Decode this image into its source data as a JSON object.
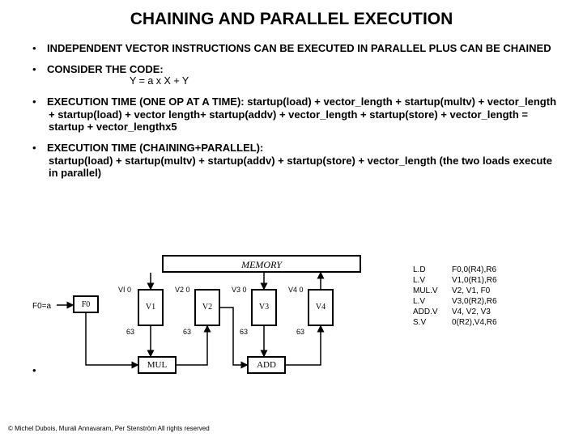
{
  "title": "CHAINING AND PARALLEL EXECUTION",
  "bullets": {
    "b1": "INDEPENDENT VECTOR INSTRUCTIONS CAN BE EXECUTED IN PARALLEL PLUS CAN BE CHAINED",
    "b2": "CONSIDER THE CODE:",
    "b2sub": "Y = a x X + Y",
    "b3label": "EXECUTION TIME (ONE OP AT A TIME):",
    "b3rest": " startup(load) + vector_length + startup(multv) + vector_length + startup(load) + vector length+ startup(addv) + vector_length + startup(store) + vector_length = startup + vector_lengthx5",
    "b4label": "EXECUTION TIME (CHAINING+PARALLEL):",
    "b4rest": "startup(load) + startup(multv) + startup(addv) +  startup(store) + vector_length (the two loads execute in parallel)"
  },
  "diagram": {
    "memory": "MEMORY",
    "f0a": "F0=a",
    "boxes": [
      "F0",
      "V1",
      "V2",
      "V3",
      "V4"
    ],
    "labels": [
      "VI 0",
      "V2 0",
      "V3 0",
      "V4 0"
    ],
    "sixes": [
      "63",
      "63",
      "63",
      "63"
    ],
    "mul": "MUL",
    "add": "ADD"
  },
  "instr": [
    {
      "op": "L.D",
      "args": "F0,0(R4),R6"
    },
    {
      "op": "L.V",
      "args": "V1,0(R1),R6"
    },
    {
      "op": "MUL.V",
      "args": "V2, V1, F0"
    },
    {
      "op": "L.V",
      "args": "V3,0(R2),R6"
    },
    {
      "op": "ADD.V",
      "args": "V4, V2, V3"
    },
    {
      "op": "S.V",
      "args": "0(R2),V4,R6"
    }
  ],
  "copyright": "© Michel Dubois, Murali Annavaram, Per Stenström All rights reserved"
}
